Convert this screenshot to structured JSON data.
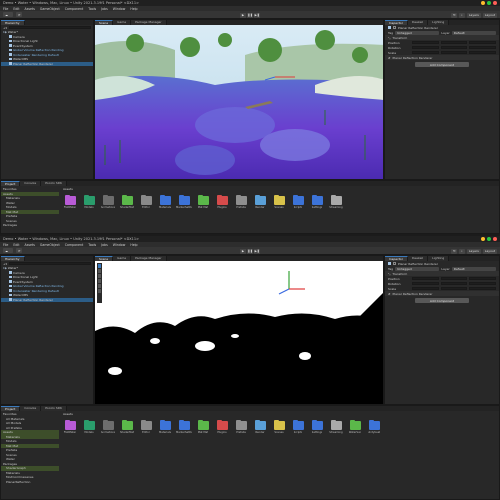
{
  "windows": [
    {
      "title": "Demo • Water • Windows, Mac, Linux • Unity 2021.3.19f1 Personal* <DX11>",
      "menu": [
        "File",
        "Edit",
        "Assets",
        "GameObject",
        "Component",
        "Tools",
        "Jobs",
        "Window",
        "Help"
      ],
      "toolbar": {
        "account": "",
        "layers": "Layers",
        "layout": "Layout"
      },
      "hierarchy": {
        "tabs": [
          "Hierarchy"
        ],
        "items": [
          "Water*",
          "Camera",
          "Directional Light",
          "EventSystem",
          "Global Volume Reflection Pending",
          "Underwater Rendering Default",
          "WaterUBS",
          "Planar Reflection Renderer"
        ],
        "selected_index": 7
      },
      "scene_tabs": [
        "Scene",
        "Game",
        "Package Manager"
      ],
      "inspector": {
        "tabs": [
          "Inspector",
          "Deekeil",
          "Lighting"
        ],
        "object_name": "Planar Reflection Renderer",
        "tag_label": "Tag",
        "tag_value": "Untagged",
        "layer_label": "Layer",
        "layer_value": "Default",
        "transform_title": "Transform",
        "position": "Position",
        "rotation": "Rotation",
        "scale": "Scale",
        "component": "Planar Reflection Renderer",
        "add_component": "Add Component"
      },
      "project": {
        "tabs": [
          "Project",
          "Console",
          "Pocolo SDK"
        ],
        "tree": [
          "Favorites",
          "Assets",
          "Materials",
          "Water",
          "Models",
          "Mat Mat",
          "Prefabs",
          "Scenes",
          "Packages"
        ],
        "assets_label": "Assets",
        "assets": [
          {
            "label": "FlatMater",
            "color": "#b85bd6"
          },
          {
            "label": "Models",
            "color": "#2a9d6c"
          },
          {
            "label": "Animations",
            "color": "#6d6d6d"
          },
          {
            "label": "ShaderMat",
            "color": "#5bb84a"
          },
          {
            "label": "Editor",
            "color": "#8a8a8a"
          },
          {
            "label": "Materials",
            "color": "#3c73d8"
          },
          {
            "label": "MarkerSetDes",
            "color": "#3c73d8"
          },
          {
            "label": "Mat Mat",
            "color": "#5bb84a"
          },
          {
            "label": "Plugins",
            "color": "#d64b4b"
          },
          {
            "label": "Prefabs",
            "color": "#8f8f8f"
          },
          {
            "label": "Render",
            "color": "#5aa0d8"
          },
          {
            "label": "Scenes",
            "color": "#d8c24a"
          },
          {
            "label": "Scripts",
            "color": "#3c73d8"
          },
          {
            "label": "Settings",
            "color": "#3c73d8"
          },
          {
            "label": "Streaming",
            "color": "#aaaaaa"
          }
        ]
      }
    },
    {
      "title": "Demo • Water • Windows, Mac, Linux • Unity 2021.3.19f1 Personal* <DX11>",
      "menu": [
        "File",
        "Edit",
        "Assets",
        "GameObject",
        "Component",
        "Tools",
        "Jobs",
        "Window",
        "Help"
      ],
      "toolbar": {
        "account": "",
        "layers": "Layers",
        "layout": "Layout"
      },
      "hierarchy": {
        "tabs": [
          "Hierarchy"
        ],
        "items": [
          "Water*",
          "Camera",
          "Directional Light",
          "EventSystem",
          "Global Volume Reflection Pending",
          "Underwater Rendering Default",
          "WaterUBS",
          "Planar Reflection Renderer"
        ],
        "selected_index": 7
      },
      "scene_tabs": [
        "Scene",
        "Game",
        "Package Manager"
      ],
      "inspector": {
        "tabs": [
          "Inspector",
          "Deekeil",
          "Lighting"
        ],
        "object_name": "Planar Reflection Renderer",
        "tag_label": "Tag",
        "tag_value": "Untagged",
        "layer_label": "Layer",
        "layer_value": "Default",
        "transform_title": "Transform",
        "position": "Position",
        "rotation": "Rotation",
        "scale": "Scale",
        "component": "Planar Reflection Renderer",
        "add_component": "Add Component"
      },
      "project": {
        "tabs": [
          "Project",
          "Console",
          "Pocolo SDK"
        ],
        "tree": [
          "Favorites",
          "All Materials",
          "All Models",
          "All Prefabs",
          "Assets",
          "Materials",
          "Models",
          "Mat Mat",
          "Prefabs",
          "Scenes",
          "Water",
          "Packages",
          "ShaderGraph",
          "Materials",
          "ModComlineLanes",
          "PlanarReflection"
        ],
        "assets_label": "Assets",
        "assets": [
          {
            "label": "FlatMater",
            "color": "#b85bd6"
          },
          {
            "label": "Models",
            "color": "#2a9d6c"
          },
          {
            "label": "Animations",
            "color": "#6d6d6d"
          },
          {
            "label": "ShaderMat",
            "color": "#5bb84a"
          },
          {
            "label": "Editor",
            "color": "#8a8a8a"
          },
          {
            "label": "Materials",
            "color": "#3c73d8"
          },
          {
            "label": "MarkerSetDes",
            "color": "#3c73d8"
          },
          {
            "label": "Mat Mat",
            "color": "#5bb84a"
          },
          {
            "label": "Plugins",
            "color": "#d64b4b"
          },
          {
            "label": "Prefabs",
            "color": "#8f8f8f"
          },
          {
            "label": "Render",
            "color": "#5aa0d8"
          },
          {
            "label": "Scenes",
            "color": "#d8c24a"
          },
          {
            "label": "Scripts",
            "color": "#3c73d8"
          },
          {
            "label": "Settings",
            "color": "#3c73d8"
          },
          {
            "label": "Streaming",
            "color": "#aaaaaa"
          },
          {
            "label": "WaterSun",
            "color": "#5bb84a"
          },
          {
            "label": "Unitybeat",
            "color": "#3c73d8"
          }
        ]
      }
    }
  ],
  "colors": {
    "traffic_red": "#ff5f57",
    "traffic_yellow": "#febc2e",
    "traffic_green": "#28c840",
    "accent": "#2c5d87"
  }
}
